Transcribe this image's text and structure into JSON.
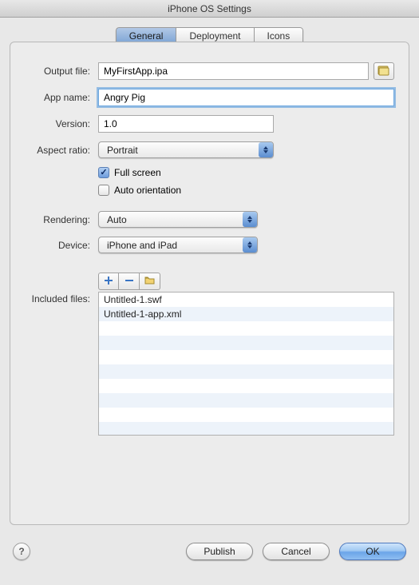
{
  "window": {
    "title": "iPhone OS Settings"
  },
  "tabs": [
    {
      "label": "General",
      "active": true
    },
    {
      "label": "Deployment",
      "active": false
    },
    {
      "label": "Icons",
      "active": false
    }
  ],
  "form": {
    "output_file": {
      "label": "Output file:",
      "value": "MyFirstApp.ipa"
    },
    "app_name": {
      "label": "App name:",
      "value": "Angry Pig"
    },
    "version": {
      "label": "Version:",
      "value": "1.0"
    },
    "aspect_ratio": {
      "label": "Aspect ratio:",
      "value": "Portrait"
    },
    "full_screen": {
      "label": "Full screen",
      "checked": true
    },
    "auto_orient": {
      "label": "Auto orientation",
      "checked": false
    },
    "rendering": {
      "label": "Rendering:",
      "value": "Auto"
    },
    "device": {
      "label": "Device:",
      "value": "iPhone and iPad"
    },
    "included": {
      "label": "Included files:"
    }
  },
  "included_files": [
    "Untitled-1.swf",
    "Untitled-1-app.xml"
  ],
  "buttons": {
    "publish": "Publish",
    "cancel": "Cancel",
    "ok": "OK"
  },
  "icons": {
    "browse": "folder-icon",
    "add": "plus-icon",
    "remove": "minus-icon",
    "folder": "folder-open-icon",
    "help": "?"
  }
}
